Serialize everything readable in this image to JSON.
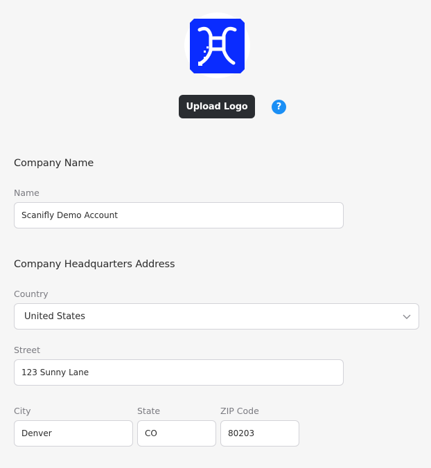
{
  "logo": {
    "icon": "scanifly-logo-icon",
    "brand_color": "#0a2cff"
  },
  "upload": {
    "button_label": "Upload Logo",
    "help_glyph": "?",
    "help_color": "#1b8ff5"
  },
  "company_name_section": {
    "title": "Company Name",
    "name_label": "Name",
    "name_value": "Scanifly Demo Account"
  },
  "address_section": {
    "title": "Company Headquarters Address",
    "country_label": "Country",
    "country_value": "United States",
    "street_label": "Street",
    "street_value": "123 Sunny Lane",
    "city_label": "City",
    "city_value": "Denver",
    "state_label": "State",
    "state_value": "CO",
    "zip_label": "ZIP Code",
    "zip_value": "80203"
  }
}
